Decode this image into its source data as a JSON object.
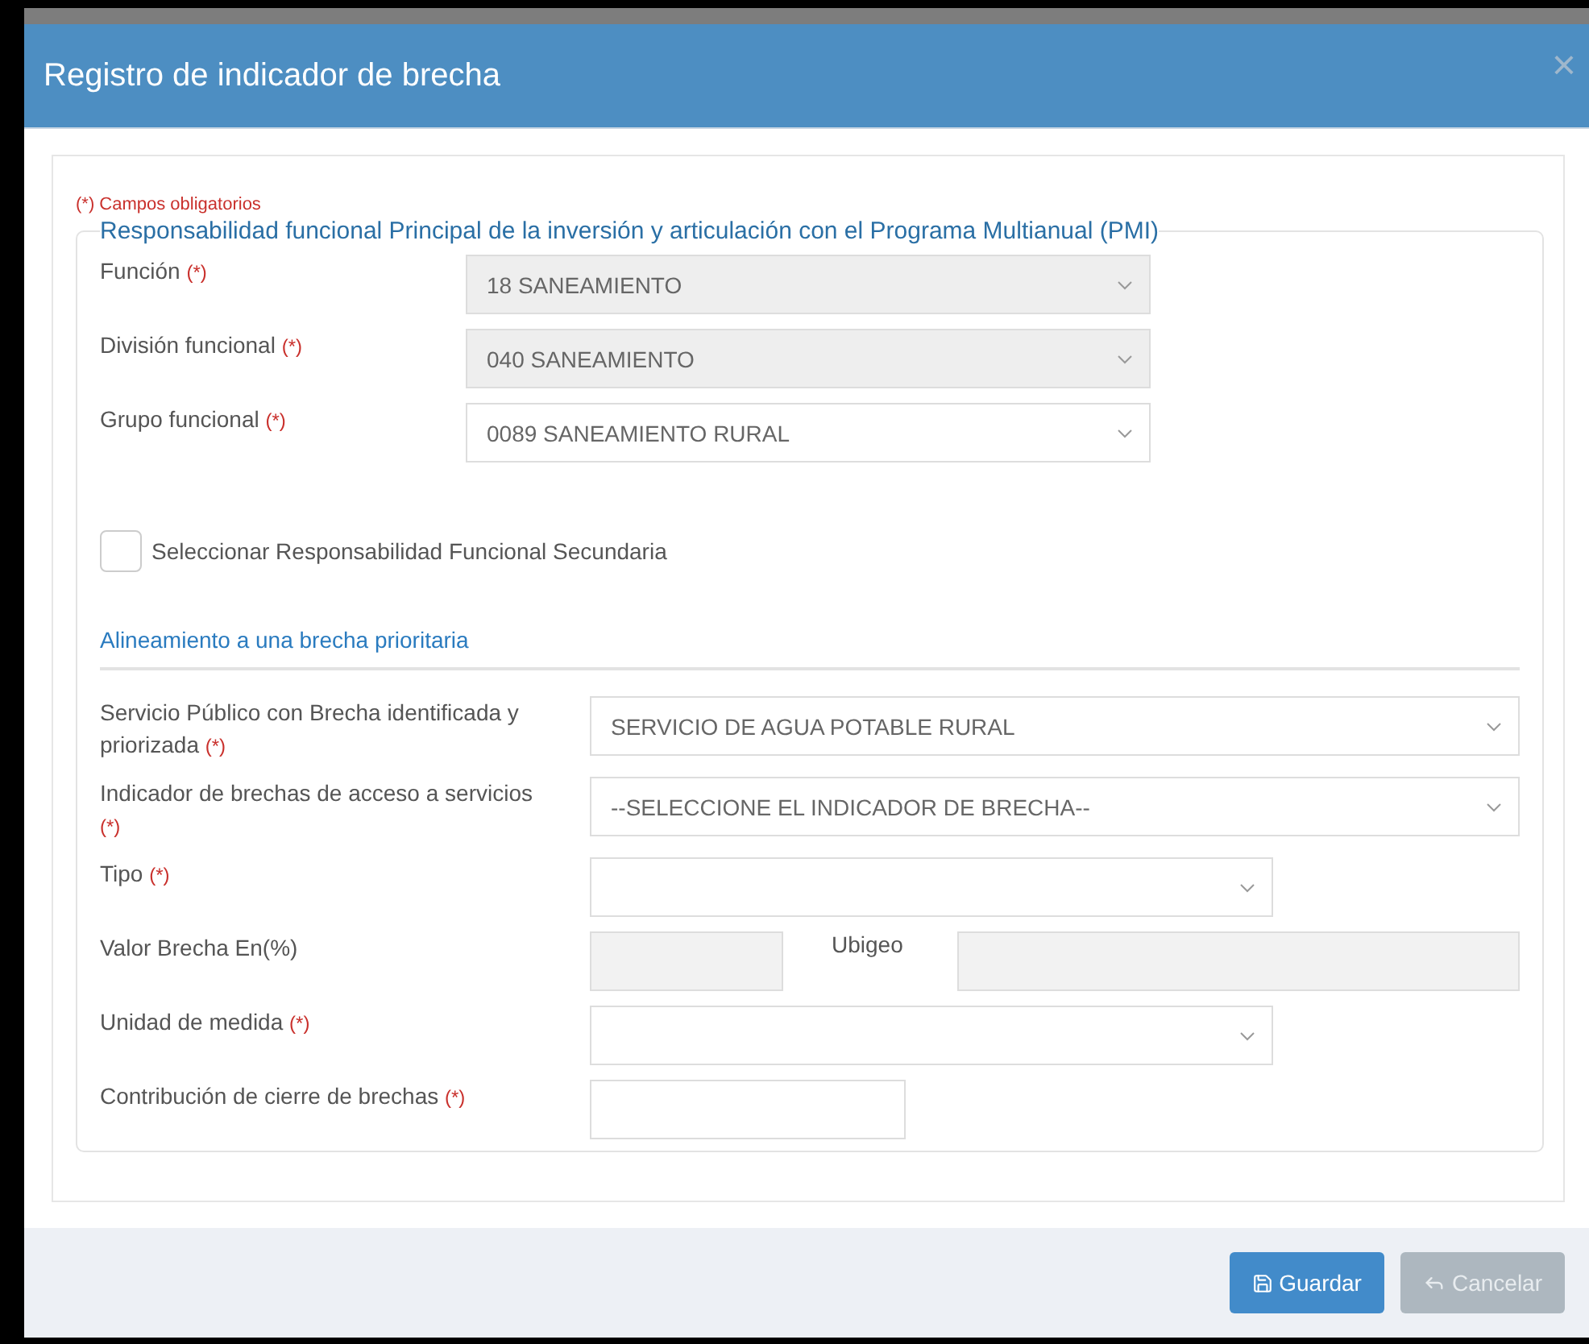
{
  "dialog": {
    "title": "Registro de indicador de brecha",
    "close": "×"
  },
  "required_note": "(*) Campos obligatorios",
  "section_main": {
    "legend": "Responsabilidad funcional Principal de la inversión y articulación con el Programa Multianual (PMI)",
    "fields": [
      {
        "label": "Función",
        "required_mark": "(*)",
        "value": "18 SANEAMIENTO",
        "disabled": true
      },
      {
        "label": "División funcional",
        "required_mark": "(*)",
        "value": "040 SANEAMIENTO",
        "disabled": true
      },
      {
        "label": "Grupo funcional",
        "required_mark": "(*)",
        "value": "0089 SANEAMIENTO RURAL",
        "disabled": false
      }
    ],
    "secondary_checkbox": {
      "label": "Seleccionar Responsabilidad Funcional Secundaria",
      "checked": false
    }
  },
  "section_gap": {
    "heading": "Alineamiento a una brecha prioritaria",
    "rows": [
      {
        "kind": "wide-select",
        "label": "Servicio Público con Brecha identificada y priorizada",
        "required_mark": "(*)",
        "value": "SERVICIO DE AGUA POTABLE RURAL"
      },
      {
        "kind": "wide-select",
        "label": "Indicador de brechas de acceso a servicios",
        "required_mark": "(*)",
        "value": "--SELECCIONE EL INDICADOR DE BRECHA--"
      },
      {
        "kind": "select",
        "label": "Tipo",
        "required_mark": "(*)"
      },
      {
        "kind": "readonly-pair",
        "label": "Valor Brecha En(%)",
        "second_label": "Ubigeo"
      },
      {
        "kind": "select",
        "label": "Unidad de medida",
        "required_mark": "(*)"
      },
      {
        "kind": "input",
        "label": "Contribución de cierre de brechas",
        "required_mark": "(*)"
      }
    ]
  },
  "buttons": [
    {
      "kind": "primary",
      "label": "Guardar",
      "disabled": false
    },
    {
      "kind": "secondary",
      "label": "Cancelar",
      "disabled": true
    }
  ]
}
